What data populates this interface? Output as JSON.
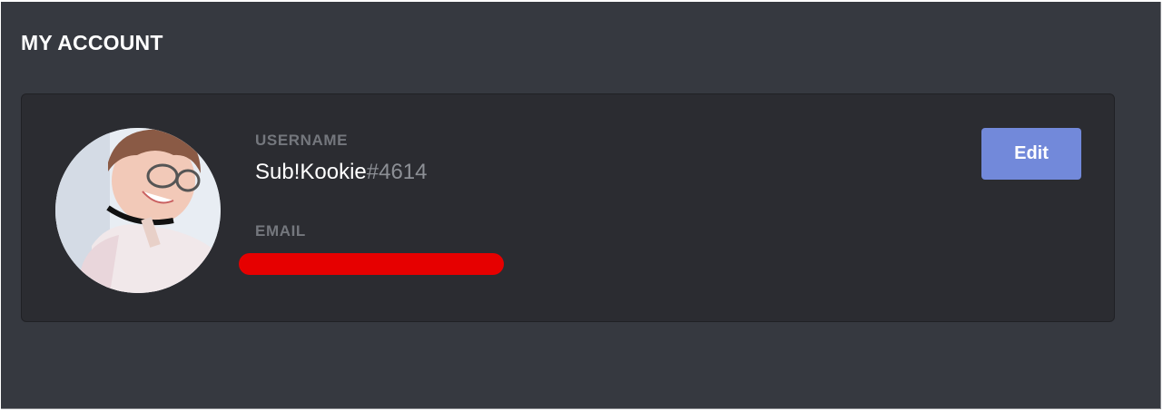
{
  "header": {
    "title": "MY ACCOUNT"
  },
  "account": {
    "username_label": "USERNAME",
    "username": "Sub!Kookie",
    "discriminator": "#4614",
    "email_label": "EMAIL",
    "email_redaction_color": "#e60000",
    "edit_label": "Edit",
    "edit_color": "#7289da"
  }
}
